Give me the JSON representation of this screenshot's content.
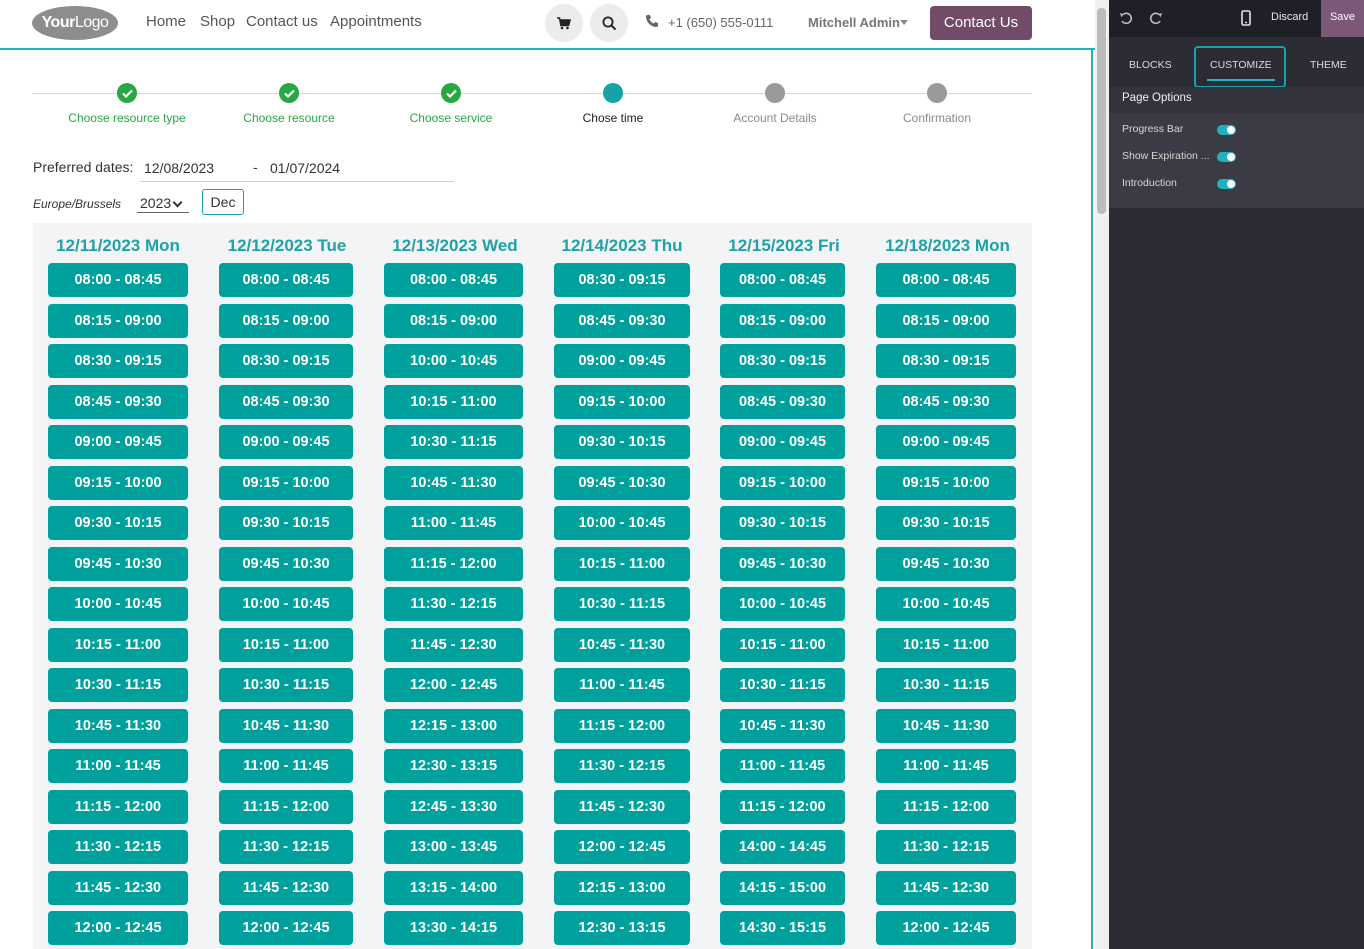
{
  "navbar": {
    "logo_bold": "Your",
    "logo_light": "Logo",
    "links": [
      "Home",
      "Shop",
      "Contact us",
      "Appointments"
    ],
    "phone": "+1 (650) 555-0111",
    "user": "Mitchell Admin",
    "contact_button": "Contact Us"
  },
  "progress": {
    "steps": [
      {
        "label": "Choose resource type",
        "state": "done"
      },
      {
        "label": "Choose resource",
        "state": "done"
      },
      {
        "label": "Choose service",
        "state": "done"
      },
      {
        "label": "Chose time",
        "state": "current"
      },
      {
        "label": "Account Details",
        "state": "todo"
      },
      {
        "label": "Confirmation",
        "state": "todo"
      }
    ],
    "colors": {
      "done": "#28a745",
      "current": "#17a2a8",
      "todo": "#9a9a9a"
    }
  },
  "filters": {
    "preferred_label": "Preferred dates:",
    "date_from": "12/08/2023",
    "date_sep": "-",
    "date_to": "01/07/2024",
    "timezone": "Europe/Brussels",
    "year": "2023",
    "month": "Dec"
  },
  "days": [
    {
      "title": "12/11/2023 Mon",
      "slots": [
        "08:00 - 08:45",
        "08:15 - 09:00",
        "08:30 - 09:15",
        "08:45 - 09:30",
        "09:00 - 09:45",
        "09:15 - 10:00",
        "09:30 - 10:15",
        "09:45 - 10:30",
        "10:00 - 10:45",
        "10:15 - 11:00",
        "10:30 - 11:15",
        "10:45 - 11:30",
        "11:00 - 11:45",
        "11:15 - 12:00",
        "11:30 - 12:15",
        "11:45 - 12:30",
        "12:00 - 12:45"
      ]
    },
    {
      "title": "12/12/2023 Tue",
      "slots": [
        "08:00 - 08:45",
        "08:15 - 09:00",
        "08:30 - 09:15",
        "08:45 - 09:30",
        "09:00 - 09:45",
        "09:15 - 10:00",
        "09:30 - 10:15",
        "09:45 - 10:30",
        "10:00 - 10:45",
        "10:15 - 11:00",
        "10:30 - 11:15",
        "10:45 - 11:30",
        "11:00 - 11:45",
        "11:15 - 12:00",
        "11:30 - 12:15",
        "11:45 - 12:30",
        "12:00 - 12:45"
      ]
    },
    {
      "title": "12/13/2023 Wed",
      "slots": [
        "08:00 - 08:45",
        "08:15 - 09:00",
        "10:00 - 10:45",
        "10:15 - 11:00",
        "10:30 - 11:15",
        "10:45 - 11:30",
        "11:00 - 11:45",
        "11:15 - 12:00",
        "11:30 - 12:15",
        "11:45 - 12:30",
        "12:00 - 12:45",
        "12:15 - 13:00",
        "12:30 - 13:15",
        "12:45 - 13:30",
        "13:00 - 13:45",
        "13:15 - 14:00",
        "13:30 - 14:15"
      ]
    },
    {
      "title": "12/14/2023 Thu",
      "slots": [
        "08:30 - 09:15",
        "08:45 - 09:30",
        "09:00 - 09:45",
        "09:15 - 10:00",
        "09:30 - 10:15",
        "09:45 - 10:30",
        "10:00 - 10:45",
        "10:15 - 11:00",
        "10:30 - 11:15",
        "10:45 - 11:30",
        "11:00 - 11:45",
        "11:15 - 12:00",
        "11:30 - 12:15",
        "11:45 - 12:30",
        "12:00 - 12:45",
        "12:15 - 13:00",
        "12:30 - 13:15"
      ]
    },
    {
      "title": "12/15/2023 Fri",
      "slots": [
        "08:00 - 08:45",
        "08:15 - 09:00",
        "08:30 - 09:15",
        "08:45 - 09:30",
        "09:00 - 09:45",
        "09:15 - 10:00",
        "09:30 - 10:15",
        "09:45 - 10:30",
        "10:00 - 10:45",
        "10:15 - 11:00",
        "10:30 - 11:15",
        "10:45 - 11:30",
        "11:00 - 11:45",
        "11:15 - 12:00",
        "14:00 - 14:45",
        "14:15 - 15:00",
        "14:30 - 15:15"
      ]
    },
    {
      "title": "12/18/2023 Mon",
      "slots": [
        "08:00 - 08:45",
        "08:15 - 09:00",
        "08:30 - 09:15",
        "08:45 - 09:30",
        "09:00 - 09:45",
        "09:15 - 10:00",
        "09:30 - 10:15",
        "09:45 - 10:30",
        "10:00 - 10:45",
        "10:15 - 11:00",
        "10:30 - 11:15",
        "10:45 - 11:30",
        "11:00 - 11:45",
        "11:15 - 12:00",
        "11:30 - 12:15",
        "11:45 - 12:30",
        "12:00 - 12:45"
      ]
    }
  ],
  "editor": {
    "icons": [
      "undo-icon",
      "redo-icon",
      "mobile-preview-icon"
    ],
    "discard": "Discard",
    "save": "Save",
    "tabs": [
      "BLOCKS",
      "CUSTOMIZE",
      "THEME"
    ],
    "active_tab": "CUSTOMIZE",
    "section_title": "Page Options",
    "options": [
      {
        "label": "Progress Bar",
        "enabled": true
      },
      {
        "label": "Show Expiration ...",
        "enabled": true
      },
      {
        "label": "Introduction",
        "enabled": true
      }
    ]
  },
  "colors": {
    "slot": "#00a09d",
    "day_title": "#1fa2a6",
    "brand": "#714b67",
    "accent": "#1fb3c0"
  }
}
